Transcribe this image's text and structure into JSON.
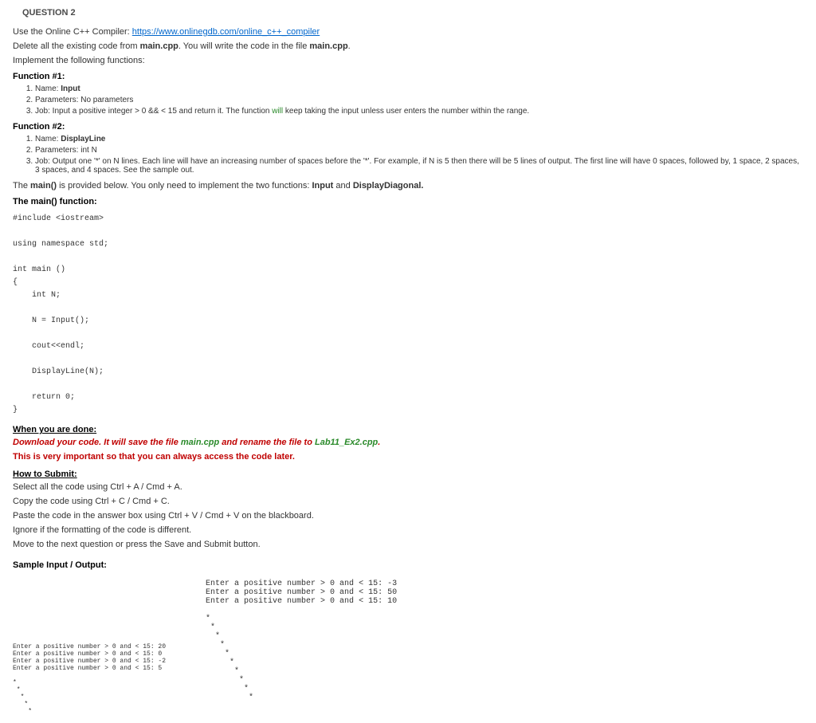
{
  "title": "QUESTION 2",
  "intro": {
    "use_compiler_prefix": "Use the Online C++ Compiler: ",
    "compiler_link": "https://www.onlinegdb.com/online_c++_compiler",
    "delete_line_a": "Delete all the existing code from ",
    "maincpp1": "main.cpp",
    "delete_line_b": ". You will write the code in the file ",
    "maincpp2": "main.cpp",
    "delete_line_c": ".",
    "implement_line": "Implement the following functions:"
  },
  "func1": {
    "head": "Function #1:",
    "name_prefix": "Name: ",
    "name": "Input",
    "params": "Parameters: No parameters",
    "job_a": "Job: Input a positive integer > 0 && < 15 and return it. The function ",
    "job_green": "will",
    "job_b": " keep taking the input unless user enters the number within the range."
  },
  "func2": {
    "head": "Function #2:",
    "name_prefix": "Name: ",
    "name": "DisplayLine",
    "params": "Parameters: int N",
    "job": "Job: Output one '*' on N lines. Each line will have an increasing number of spaces before the '*'. For example, if N is 5 then there will be 5 lines of output. The first line will have 0 spaces, followed by, 1 space, 2 spaces, 3 spaces, and 4 spaces. See the sample out."
  },
  "main_note": {
    "a": "The ",
    "main_b": "main()",
    "b": " is provided below. You only need to implement the two functions: ",
    "input_b": "Input",
    "c": " and ",
    "dd_b": "DisplayDiagonal."
  },
  "main_head": "The main() function:",
  "code": "#include <iostream>\n\nusing namespace std;\n\nint main ()\n{\n    int N;\n\n    N = Input();\n\n    cout<<endl;\n\n    DisplayLine(N);\n\n    return 0;\n}",
  "when_done": "When you are done:",
  "download_a": "Download your code. It will save the file ",
  "download_green": "main.cpp",
  "download_b": " and rename the file to ",
  "download_green2": "Lab11_Ex2.cpp",
  "download_c": ".",
  "download_line2": "This is very important so that you can always access the code later.",
  "howto_head": "How to Submit:",
  "howto": {
    "l1": "Select all the code using Ctrl + A / Cmd + A.",
    "l2": "Copy the code using Ctrl + C / Cmd + C.",
    "l3": "Paste the code in the answer box using Ctrl + V / Cmd + V on the blackboard.",
    "l4": "Ignore if the formatting of the code is different.",
    "l5": "Move to the next question or press the Save and Submit button."
  },
  "sample_head": "Sample Input / Output:",
  "sample_left": "Enter a positive number > 0 and < 15: 20\nEnter a positive number > 0 and < 15: 0\nEnter a positive number > 0 and < 15: -2\nEnter a positive number > 0 and < 15: 5\n\n*\n *\n  *\n   *\n    *",
  "sample_right": "Enter a positive number > 0 and < 15: -3\nEnter a positive number > 0 and < 15: 50\nEnter a positive number > 0 and < 15: 10\n\n*\n *\n  *\n   *\n    *\n     *\n      *\n       *\n        *\n         *"
}
